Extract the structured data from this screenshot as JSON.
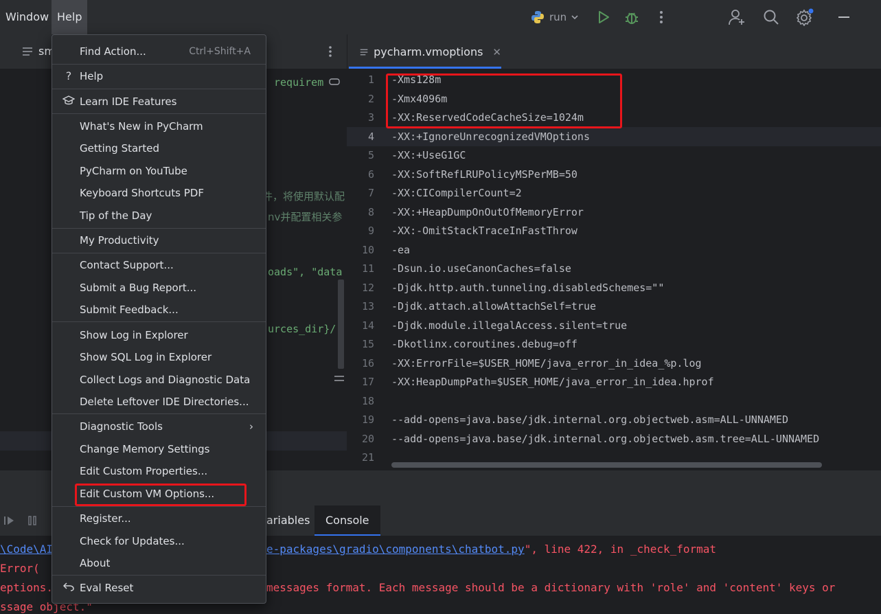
{
  "menubar": {
    "window_label": "Window",
    "help_label": "Help",
    "run_config": "run"
  },
  "left_editor": {
    "tab_partial": "sm",
    "fragments": {
      "requirem": "requirem",
      "chinese_1": "件，将使用默认配",
      "chinese_2": "nv并配置相关参",
      "loads": "oads\", \"data",
      "sources": "urces_dir}/"
    }
  },
  "right_editor": {
    "tab_title": "pycharm.vmoptions",
    "lines": [
      {
        "n": "1",
        "text": "-Xms128m"
      },
      {
        "n": "2",
        "text": "-Xmx4096m"
      },
      {
        "n": "3",
        "text": "-XX:ReservedCodeCacheSize=1024m"
      },
      {
        "n": "4",
        "text": "-XX:+IgnoreUnrecognizedVMOptions"
      },
      {
        "n": "5",
        "text": "-XX:+UseG1GC"
      },
      {
        "n": "6",
        "text": "-XX:SoftRefLRUPolicyMSPerMB=50"
      },
      {
        "n": "7",
        "text": "-XX:CICompilerCount=2"
      },
      {
        "n": "8",
        "text": "-XX:+HeapDumpOnOutOfMemoryError"
      },
      {
        "n": "9",
        "text": "-XX:-OmitStackTraceInFastThrow"
      },
      {
        "n": "10",
        "text": "-ea"
      },
      {
        "n": "11",
        "text": "-Dsun.io.useCanonCaches=false"
      },
      {
        "n": "12",
        "text": "-Djdk.http.auth.tunneling.disabledSchemes=\"\""
      },
      {
        "n": "13",
        "text": "-Djdk.attach.allowAttachSelf=true"
      },
      {
        "n": "14",
        "text": "-Djdk.module.illegalAccess.silent=true"
      },
      {
        "n": "15",
        "text": "-Dkotlinx.coroutines.debug=off"
      },
      {
        "n": "16",
        "text": "-XX:ErrorFile=$USER_HOME/java_error_in_idea_%p.log"
      },
      {
        "n": "17",
        "text": "-XX:HeapDumpPath=$USER_HOME/java_error_in_idea.hprof"
      },
      {
        "n": "18",
        "text": ""
      },
      {
        "n": "19",
        "text": "--add-opens=java.base/jdk.internal.org.objectweb.asm=ALL-UNNAMED"
      },
      {
        "n": "20",
        "text": "--add-opens=java.base/jdk.internal.org.objectweb.asm.tree=ALL-UNNAMED"
      },
      {
        "n": "21",
        "text": ""
      }
    ]
  },
  "bottom_panel": {
    "tab_variables": "ariables",
    "tab_console": "Console",
    "console": {
      "l1_path_a": "\\Code\\AI",
      "l1_path_b": "e-packages\\gradio\\components\\chatbot.py",
      "l1_rest": "\", line 422, in _check_format",
      "l2": "Error(",
      "l3_a": "eptions.",
      "l3_b": "messages format. Each message should be a dictionary with 'role' and 'content' keys or",
      "l4": "ssage object.\""
    }
  },
  "help_menu": {
    "find_action": "Find Action...",
    "find_action_shortcut": "Ctrl+Shift+A",
    "help": "Help",
    "learn": "Learn IDE Features",
    "whats_new": "What's New in PyCharm",
    "getting_started": "Getting Started",
    "youtube": "PyCharm on YouTube",
    "shortcuts_pdf": "Keyboard Shortcuts PDF",
    "tip": "Tip of the Day",
    "productivity": "My Productivity",
    "contact": "Contact Support...",
    "bug": "Submit a Bug Report...",
    "feedback": "Submit Feedback...",
    "show_log": "Show Log in Explorer",
    "show_sql_log": "Show SQL Log in Explorer",
    "collect_logs": "Collect Logs and Diagnostic Data",
    "delete_leftover": "Delete Leftover IDE Directories...",
    "diagnostic": "Diagnostic Tools",
    "memory": "Change Memory Settings",
    "custom_props": "Edit Custom Properties...",
    "custom_vm": "Edit Custom VM Options...",
    "register": "Register...",
    "updates": "Check for Updates...",
    "about": "About",
    "eval_reset": "Eval Reset"
  }
}
